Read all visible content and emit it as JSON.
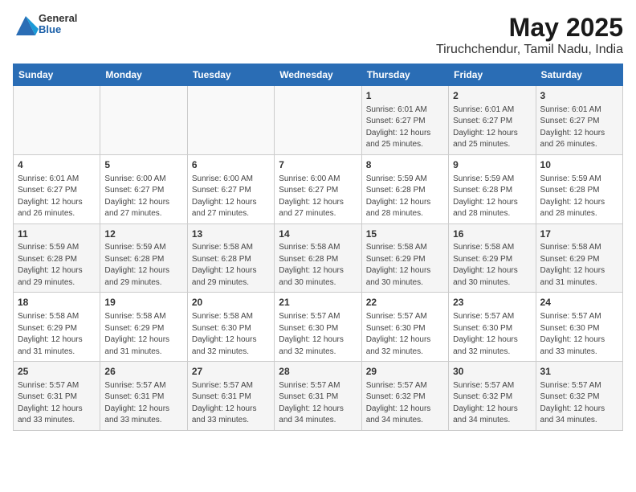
{
  "header": {
    "logo_general": "General",
    "logo_blue": "Blue",
    "title": "May 2025",
    "subtitle": "Tiruchchendur, Tamil Nadu, India"
  },
  "weekdays": [
    "Sunday",
    "Monday",
    "Tuesday",
    "Wednesday",
    "Thursday",
    "Friday",
    "Saturday"
  ],
  "weeks": [
    [
      {
        "day": "",
        "info": ""
      },
      {
        "day": "",
        "info": ""
      },
      {
        "day": "",
        "info": ""
      },
      {
        "day": "",
        "info": ""
      },
      {
        "day": "1",
        "info": "Sunrise: 6:01 AM\nSunset: 6:27 PM\nDaylight: 12 hours\nand 25 minutes."
      },
      {
        "day": "2",
        "info": "Sunrise: 6:01 AM\nSunset: 6:27 PM\nDaylight: 12 hours\nand 25 minutes."
      },
      {
        "day": "3",
        "info": "Sunrise: 6:01 AM\nSunset: 6:27 PM\nDaylight: 12 hours\nand 26 minutes."
      }
    ],
    [
      {
        "day": "4",
        "info": "Sunrise: 6:01 AM\nSunset: 6:27 PM\nDaylight: 12 hours\nand 26 minutes."
      },
      {
        "day": "5",
        "info": "Sunrise: 6:00 AM\nSunset: 6:27 PM\nDaylight: 12 hours\nand 27 minutes."
      },
      {
        "day": "6",
        "info": "Sunrise: 6:00 AM\nSunset: 6:27 PM\nDaylight: 12 hours\nand 27 minutes."
      },
      {
        "day": "7",
        "info": "Sunrise: 6:00 AM\nSunset: 6:27 PM\nDaylight: 12 hours\nand 27 minutes."
      },
      {
        "day": "8",
        "info": "Sunrise: 5:59 AM\nSunset: 6:28 PM\nDaylight: 12 hours\nand 28 minutes."
      },
      {
        "day": "9",
        "info": "Sunrise: 5:59 AM\nSunset: 6:28 PM\nDaylight: 12 hours\nand 28 minutes."
      },
      {
        "day": "10",
        "info": "Sunrise: 5:59 AM\nSunset: 6:28 PM\nDaylight: 12 hours\nand 28 minutes."
      }
    ],
    [
      {
        "day": "11",
        "info": "Sunrise: 5:59 AM\nSunset: 6:28 PM\nDaylight: 12 hours\nand 29 minutes."
      },
      {
        "day": "12",
        "info": "Sunrise: 5:59 AM\nSunset: 6:28 PM\nDaylight: 12 hours\nand 29 minutes."
      },
      {
        "day": "13",
        "info": "Sunrise: 5:58 AM\nSunset: 6:28 PM\nDaylight: 12 hours\nand 29 minutes."
      },
      {
        "day": "14",
        "info": "Sunrise: 5:58 AM\nSunset: 6:28 PM\nDaylight: 12 hours\nand 30 minutes."
      },
      {
        "day": "15",
        "info": "Sunrise: 5:58 AM\nSunset: 6:29 PM\nDaylight: 12 hours\nand 30 minutes."
      },
      {
        "day": "16",
        "info": "Sunrise: 5:58 AM\nSunset: 6:29 PM\nDaylight: 12 hours\nand 30 minutes."
      },
      {
        "day": "17",
        "info": "Sunrise: 5:58 AM\nSunset: 6:29 PM\nDaylight: 12 hours\nand 31 minutes."
      }
    ],
    [
      {
        "day": "18",
        "info": "Sunrise: 5:58 AM\nSunset: 6:29 PM\nDaylight: 12 hours\nand 31 minutes."
      },
      {
        "day": "19",
        "info": "Sunrise: 5:58 AM\nSunset: 6:29 PM\nDaylight: 12 hours\nand 31 minutes."
      },
      {
        "day": "20",
        "info": "Sunrise: 5:58 AM\nSunset: 6:30 PM\nDaylight: 12 hours\nand 32 minutes."
      },
      {
        "day": "21",
        "info": "Sunrise: 5:57 AM\nSunset: 6:30 PM\nDaylight: 12 hours\nand 32 minutes."
      },
      {
        "day": "22",
        "info": "Sunrise: 5:57 AM\nSunset: 6:30 PM\nDaylight: 12 hours\nand 32 minutes."
      },
      {
        "day": "23",
        "info": "Sunrise: 5:57 AM\nSunset: 6:30 PM\nDaylight: 12 hours\nand 32 minutes."
      },
      {
        "day": "24",
        "info": "Sunrise: 5:57 AM\nSunset: 6:30 PM\nDaylight: 12 hours\nand 33 minutes."
      }
    ],
    [
      {
        "day": "25",
        "info": "Sunrise: 5:57 AM\nSunset: 6:31 PM\nDaylight: 12 hours\nand 33 minutes."
      },
      {
        "day": "26",
        "info": "Sunrise: 5:57 AM\nSunset: 6:31 PM\nDaylight: 12 hours\nand 33 minutes."
      },
      {
        "day": "27",
        "info": "Sunrise: 5:57 AM\nSunset: 6:31 PM\nDaylight: 12 hours\nand 33 minutes."
      },
      {
        "day": "28",
        "info": "Sunrise: 5:57 AM\nSunset: 6:31 PM\nDaylight: 12 hours\nand 34 minutes."
      },
      {
        "day": "29",
        "info": "Sunrise: 5:57 AM\nSunset: 6:32 PM\nDaylight: 12 hours\nand 34 minutes."
      },
      {
        "day": "30",
        "info": "Sunrise: 5:57 AM\nSunset: 6:32 PM\nDaylight: 12 hours\nand 34 minutes."
      },
      {
        "day": "31",
        "info": "Sunrise: 5:57 AM\nSunset: 6:32 PM\nDaylight: 12 hours\nand 34 minutes."
      }
    ]
  ]
}
